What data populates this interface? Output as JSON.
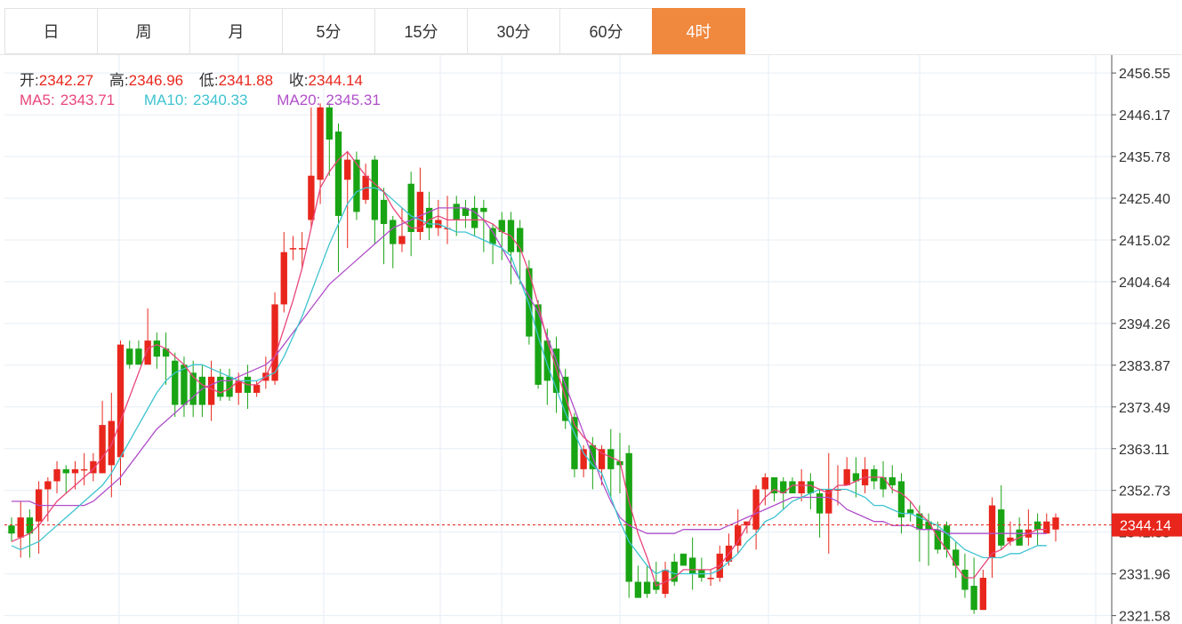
{
  "tabs": [
    {
      "label": "日",
      "active": false
    },
    {
      "label": "周",
      "active": false
    },
    {
      "label": "月",
      "active": false
    },
    {
      "label": "5分",
      "active": false
    },
    {
      "label": "15分",
      "active": false
    },
    {
      "label": "30分",
      "active": false
    },
    {
      "label": "60分",
      "active": false
    },
    {
      "label": "4时",
      "active": true
    }
  ],
  "ohlc": {
    "open_label": "开:",
    "open": "2342.27",
    "high_label": "高:",
    "high": "2346.96",
    "low_label": "低:",
    "low": "2341.88",
    "close_label": "收:",
    "close": "2344.14"
  },
  "ma": {
    "ma5_label": "MA5:",
    "ma5": "2343.71",
    "ma10_label": "MA10:",
    "ma10": "2340.33",
    "ma20_label": "MA20:",
    "ma20": "2345.31"
  },
  "colors": {
    "up": "#e8261c",
    "down": "#19a414",
    "ma5": "#e8457a",
    "ma10": "#3ec3d0",
    "ma20": "#b04fc9",
    "accent": "#f0883e",
    "grid": "#e6eef5"
  },
  "chart_data": {
    "type": "candlestick",
    "title": "",
    "ylim": [
      2319.5,
      2461.0
    ],
    "y_ticks": [
      "2456.55",
      "2446.17",
      "2435.78",
      "2425.40",
      "2415.02",
      "2404.64",
      "2394.26",
      "2383.87",
      "2373.49",
      "2363.11",
      "2352.73",
      "2342.35",
      "2331.96",
      "2321.58"
    ],
    "last_price": "2344.14",
    "grid": true,
    "candles": [
      [
        2344,
        2342,
        2346,
        2340
      ],
      [
        2341,
        2346,
        2350,
        2336
      ],
      [
        2346,
        2342,
        2348,
        2336
      ],
      [
        2345,
        2353,
        2355,
        2337
      ],
      [
        2353,
        2355,
        2356,
        2345
      ],
      [
        2355,
        2358,
        2360,
        2352
      ],
      [
        2358,
        2357,
        2359,
        2352
      ],
      [
        2357,
        2358,
        2360,
        2353
      ],
      [
        2358,
        2358,
        2362,
        2354
      ],
      [
        2357,
        2360,
        2362,
        2355
      ],
      [
        2357,
        2369,
        2375,
        2358
      ],
      [
        2359,
        2370,
        2377,
        2351
      ],
      [
        2361,
        2389,
        2390,
        2354
      ],
      [
        2388,
        2384,
        2390,
        2383
      ],
      [
        2388,
        2384,
        2390,
        2384
      ],
      [
        2384,
        2390,
        2398,
        2385
      ],
      [
        2390,
        2386,
        2392,
        2383
      ],
      [
        2388,
        2386,
        2392,
        2379
      ],
      [
        2385,
        2374,
        2387,
        2371
      ],
      [
        2384,
        2374,
        2386,
        2371
      ],
      [
        2382,
        2374,
        2385,
        2371
      ],
      [
        2381,
        2374,
        2384,
        2371
      ],
      [
        2374,
        2381,
        2385,
        2370
      ],
      [
        2381,
        2376,
        2383,
        2375
      ],
      [
        2381,
        2376,
        2383,
        2375
      ],
      [
        2377,
        2380,
        2382,
        2374
      ],
      [
        2381,
        2377,
        2384,
        2373
      ],
      [
        2377,
        2379,
        2380,
        2376
      ],
      [
        2380,
        2382,
        2386,
        2378
      ],
      [
        2380,
        2399,
        2402,
        2379
      ],
      [
        2399,
        2412,
        2417,
        2397
      ],
      [
        2413,
        2413,
        2416,
        2410
      ],
      [
        2413,
        2413,
        2417,
        2408
      ],
      [
        2420,
        2431,
        2448,
        2418
      ],
      [
        2430,
        2448,
        2449,
        2424
      ],
      [
        2448,
        2440,
        2449,
        2431
      ],
      [
        2442,
        2421,
        2444,
        2407
      ],
      [
        2430,
        2435,
        2437,
        2413
      ],
      [
        2435,
        2422,
        2437,
        2420
      ],
      [
        2425,
        2431,
        2434,
        2424
      ],
      [
        2435,
        2420,
        2436,
        2414
      ],
      [
        2425,
        2419,
        2428,
        2409
      ],
      [
        2420,
        2414,
        2421,
        2408
      ],
      [
        2414,
        2416,
        2423,
        2412
      ],
      [
        2429,
        2417,
        2432,
        2411
      ],
      [
        2417,
        2427,
        2433,
        2415
      ],
      [
        2423,
        2418,
        2427,
        2415
      ],
      [
        2418,
        2420,
        2425,
        2416
      ],
      [
        2418,
        2418,
        2426,
        2414
      ],
      [
        2424,
        2420,
        2426,
        2416
      ],
      [
        2423,
        2421,
        2425,
        2418
      ],
      [
        2423,
        2418,
        2426,
        2416
      ],
      [
        2423,
        2422,
        2425,
        2412
      ],
      [
        2418,
        2414,
        2419,
        2409
      ],
      [
        2420,
        2417,
        2422,
        2410
      ],
      [
        2420,
        2412,
        2422,
        2404
      ],
      [
        2418,
        2412,
        2420,
        2404
      ],
      [
        2408,
        2391,
        2410,
        2389
      ],
      [
        2399,
        2379,
        2400,
        2378
      ],
      [
        2390,
        2380,
        2393,
        2374
      ],
      [
        2388,
        2377,
        2391,
        2372
      ],
      [
        2381,
        2370,
        2383,
        2368
      ],
      [
        2371,
        2358,
        2372,
        2356
      ],
      [
        2358,
        2363,
        2364,
        2356
      ],
      [
        2364,
        2358,
        2366,
        2353
      ],
      [
        2358,
        2363,
        2364,
        2354
      ],
      [
        2363,
        2358,
        2368,
        2351
      ],
      [
        2360,
        2359,
        2367,
        2352
      ],
      [
        2362,
        2330,
        2364,
        2326
      ],
      [
        2330,
        2326,
        2334,
        2326
      ],
      [
        2330,
        2327,
        2334,
        2326
      ],
      [
        2330,
        2328,
        2335,
        2327
      ],
      [
        2327,
        2333,
        2335,
        2326
      ],
      [
        2335,
        2330,
        2337,
        2329
      ],
      [
        2337,
        2334,
        2337,
        2334
      ],
      [
        2336,
        2332,
        2341,
        2328
      ],
      [
        2333,
        2331,
        2336,
        2330
      ],
      [
        2331,
        2331,
        2333,
        2329
      ],
      [
        2331,
        2337,
        2339,
        2330
      ],
      [
        2335,
        2339,
        2342,
        2334
      ],
      [
        2339,
        2344,
        2348,
        2337
      ],
      [
        2344,
        2345,
        2345,
        2342
      ],
      [
        2343,
        2353,
        2354,
        2338
      ],
      [
        2353,
        2356,
        2357,
        2349
      ],
      [
        2356,
        2352,
        2356,
        2350
      ],
      [
        2355,
        2352,
        2356,
        2348
      ],
      [
        2355,
        2352,
        2356,
        2352
      ],
      [
        2352,
        2355,
        2358,
        2350
      ],
      [
        2355,
        2352,
        2357,
        2348
      ],
      [
        2352,
        2347,
        2353,
        2341
      ],
      [
        2347,
        2353,
        2362,
        2337
      ],
      [
        2353,
        2353,
        2359,
        2349
      ],
      [
        2354,
        2358,
        2361,
        2355
      ],
      [
        2357,
        2355,
        2361,
        2351
      ],
      [
        2354,
        2358,
        2361,
        2352
      ],
      [
        2358,
        2355,
        2359,
        2353
      ],
      [
        2356,
        2353,
        2360,
        2351
      ],
      [
        2356,
        2354,
        2359,
        2352
      ],
      [
        2355,
        2346,
        2357,
        2342
      ],
      [
        2348,
        2347,
        2350,
        2345
      ],
      [
        2347,
        2343,
        2349,
        2335
      ],
      [
        2345,
        2343,
        2347,
        2334
      ],
      [
        2343,
        2338,
        2345,
        2337
      ],
      [
        2344,
        2338,
        2345,
        2336
      ],
      [
        2338,
        2334,
        2340,
        2331
      ],
      [
        2333,
        2328,
        2337,
        2326
      ],
      [
        2329,
        2323,
        2336,
        2322
      ],
      [
        2323,
        2331,
        2333,
        2323
      ],
      [
        2336,
        2349,
        2351,
        2331
      ],
      [
        2348,
        2339,
        2354,
        2338
      ],
      [
        2340,
        2341,
        2345,
        2339
      ],
      [
        2343,
        2339,
        2346,
        2341
      ],
      [
        2341,
        2343,
        2348,
        2339
      ],
      [
        2345,
        2343,
        2347,
        2339
      ],
      [
        2342,
        2345,
        2347,
        2342
      ],
      [
        2343,
        2346,
        2347,
        2340
      ]
    ],
    "ma5": [
      2340,
      2341,
      2342,
      2344,
      2347,
      2350,
      2352,
      2354,
      2356,
      2358,
      2361,
      2364,
      2370,
      2376,
      2382,
      2388,
      2389,
      2388,
      2386,
      2384,
      2381,
      2379,
      2378,
      2377,
      2378,
      2380,
      2379,
      2379,
      2381,
      2386,
      2393,
      2400,
      2408,
      2418,
      2428,
      2432,
      2435,
      2437,
      2434,
      2431,
      2429,
      2427,
      2423,
      2420,
      2418,
      2418,
      2420,
      2421,
      2420,
      2420,
      2420,
      2420,
      2420,
      2419,
      2417,
      2416,
      2413,
      2407,
      2399,
      2390,
      2383,
      2376,
      2369,
      2366,
      2364,
      2362,
      2361,
      2360,
      2350,
      2342,
      2336,
      2329,
      2330,
      2331,
      2333,
      2333,
      2333,
      2333,
      2334,
      2337,
      2340,
      2344,
      2348,
      2351,
      2353,
      2352,
      2354,
      2354,
      2354,
      2353,
      2352,
      2354,
      2354,
      2355,
      2356,
      2356,
      2356,
      2353,
      2352,
      2350,
      2347,
      2345,
      2341,
      2338,
      2334,
      2331,
      2331,
      2334,
      2337,
      2338,
      2340,
      2341,
      2342,
      2343,
      2343
    ],
    "ma10": [
      2339,
      2338,
      2339,
      2340,
      2342,
      2344,
      2346,
      2348,
      2350,
      2352,
      2354,
      2357,
      2361,
      2365,
      2369,
      2373,
      2377,
      2380,
      2382,
      2383,
      2384,
      2384,
      2383,
      2382,
      2381,
      2380,
      2380,
      2380,
      2381,
      2382,
      2386,
      2391,
      2396,
      2402,
      2408,
      2414,
      2419,
      2424,
      2427,
      2428,
      2428,
      2427,
      2425,
      2423,
      2421,
      2420,
      2419,
      2419,
      2418,
      2417,
      2417,
      2416,
      2415,
      2414,
      2413,
      2411,
      2405,
      2399,
      2391,
      2384,
      2378,
      2372,
      2367,
      2362,
      2359,
      2357,
      2351,
      2345,
      2340,
      2337,
      2334,
      2332,
      2333,
      2332,
      2332,
      2332,
      2332,
      2332,
      2333,
      2335,
      2337,
      2340,
      2342,
      2345,
      2346,
      2348,
      2350,
      2351,
      2352,
      2353,
      2353,
      2353,
      2353,
      2352,
      2351,
      2349,
      2349,
      2348,
      2347,
      2347,
      2346,
      2345,
      2344,
      2342,
      2340,
      2338,
      2337,
      2336,
      2336,
      2336,
      2337,
      2337,
      2338,
      2339,
      2339
    ],
    "ma20": [
      2350,
      2350,
      2350,
      2349,
      2349,
      2349,
      2349,
      2349,
      2349,
      2350,
      2352,
      2354,
      2356,
      2359,
      2362,
      2365,
      2368,
      2370,
      2372,
      2374,
      2376,
      2378,
      2379,
      2380,
      2380,
      2381,
      2382,
      2383,
      2384,
      2386,
      2389,
      2392,
      2395,
      2398,
      2401,
      2404,
      2406,
      2408,
      2410,
      2412,
      2414,
      2416,
      2418,
      2419,
      2420,
      2421,
      2422,
      2423,
      2423,
      2423,
      2423,
      2422,
      2420,
      2417,
      2413,
      2409,
      2405,
      2401,
      2397,
      2391,
      2385,
      2379,
      2373,
      2367,
      2361,
      2355,
      2350,
      2346,
      2344,
      2343,
      2342,
      2342,
      2342,
      2342,
      2343,
      2343,
      2343,
      2343,
      2343,
      2344,
      2345,
      2346,
      2347,
      2348,
      2349,
      2350,
      2351,
      2351,
      2351,
      2351,
      2351,
      2350,
      2348,
      2347,
      2346,
      2345,
      2345,
      2344,
      2344,
      2344,
      2343,
      2343,
      2343,
      2342,
      2342,
      2342,
      2342,
      2342,
      2342,
      2342,
      2342,
      2342,
      2342,
      2342,
      2342
    ]
  }
}
